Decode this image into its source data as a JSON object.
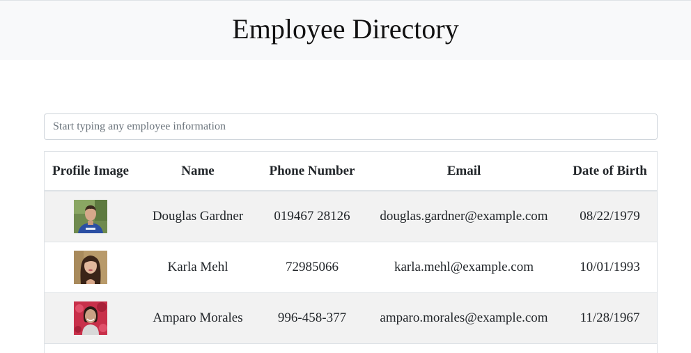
{
  "header": {
    "title": "Employee Directory"
  },
  "search": {
    "placeholder": "Start typing any employee information",
    "value": ""
  },
  "table": {
    "columns": [
      "Profile Image",
      "Name",
      "Phone Number",
      "Email",
      "Date of Birth"
    ],
    "rows": [
      {
        "avatar": "profile-photo-man-blue-shirt-outdoors",
        "name": "Douglas Gardner",
        "phone": "019467 28126",
        "email": "douglas.gardner@example.com",
        "dob": "08/22/1979"
      },
      {
        "avatar": "profile-photo-woman-dark-hair",
        "name": "Karla Mehl",
        "phone": "72985066",
        "email": "karla.mehl@example.com",
        "dob": "10/01/1993"
      },
      {
        "avatar": "profile-photo-woman-red-background",
        "name": "Amparo Morales",
        "phone": "996-458-377",
        "email": "amparo.morales@example.com",
        "dob": "11/28/1967"
      }
    ]
  }
}
